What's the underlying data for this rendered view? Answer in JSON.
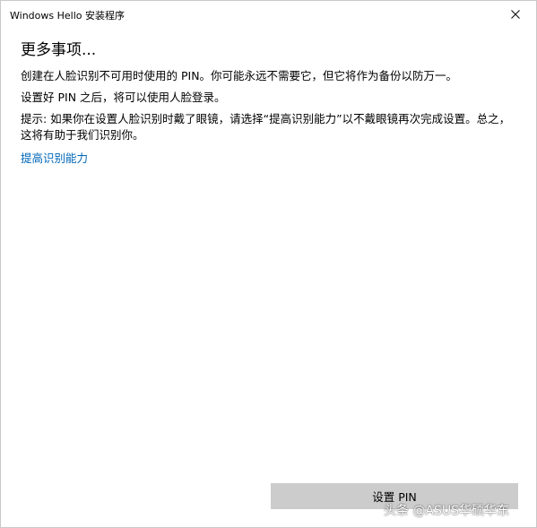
{
  "window": {
    "title": "Windows Hello 安装程序",
    "close_icon": "close-icon"
  },
  "main": {
    "heading": "更多事项...",
    "paragraphs": [
      "创建在人脸识别不可用时使用的 PIN。你可能永远不需要它，但它将作为备份以防万一。",
      "设置好 PIN 之后，将可以使用人脸登录。",
      "提示: 如果你在设置人脸识别时戴了眼镜，请选择“提高识别能力”以不戴眼镜再次完成设置。总之，这将有助于我们识别你。"
    ],
    "link_label": "提高识别能力"
  },
  "footer": {
    "primary_button_label": "设置 PIN"
  },
  "watermark": "头条 @ASUS华硕华东",
  "colors": {
    "link": "#0067b8",
    "button_bg": "#cccccc",
    "border": "#c8c8c8"
  }
}
